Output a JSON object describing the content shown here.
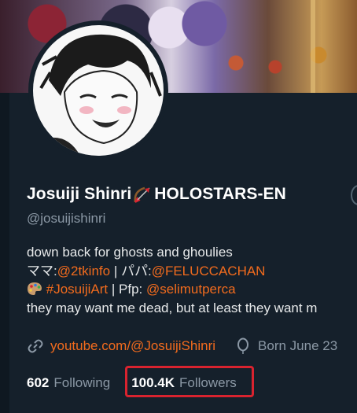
{
  "profile": {
    "display_name": "Josuiji Shinri",
    "display_name_suffix": "HOLOSTARS-EN",
    "handle": "@josuijishinri",
    "bio": {
      "line1": "down back for ghosts and ghoulies",
      "line2_mama_label": "ママ:",
      "line2_mama_link": "@2tkinfo",
      "line2_sep": " | パパ:",
      "line2_papa_link": "@FELUCCACHAN",
      "line3_tag_link": "#JosuijiArt",
      "line3_pfp_label": " | Pfp: ",
      "line3_pfp_link": "@selimutperca",
      "line4": "they may want me dead, but at least they want m"
    },
    "website": "youtube.com/@JosuijiShinri",
    "born": "Born June 23",
    "following_count": "602",
    "following_label": "Following",
    "followers_count": "100.4K",
    "followers_label": "Followers"
  },
  "colors": {
    "background": "#15202b",
    "link": "#f26b1d",
    "muted": "#8b98a5",
    "highlight_box": "#d9232f"
  },
  "icons": {
    "name_emoji": "bow-and-arrow-icon",
    "bio_emoji": "artist-palette-icon",
    "website": "link-icon",
    "birthday": "balloon-icon"
  }
}
